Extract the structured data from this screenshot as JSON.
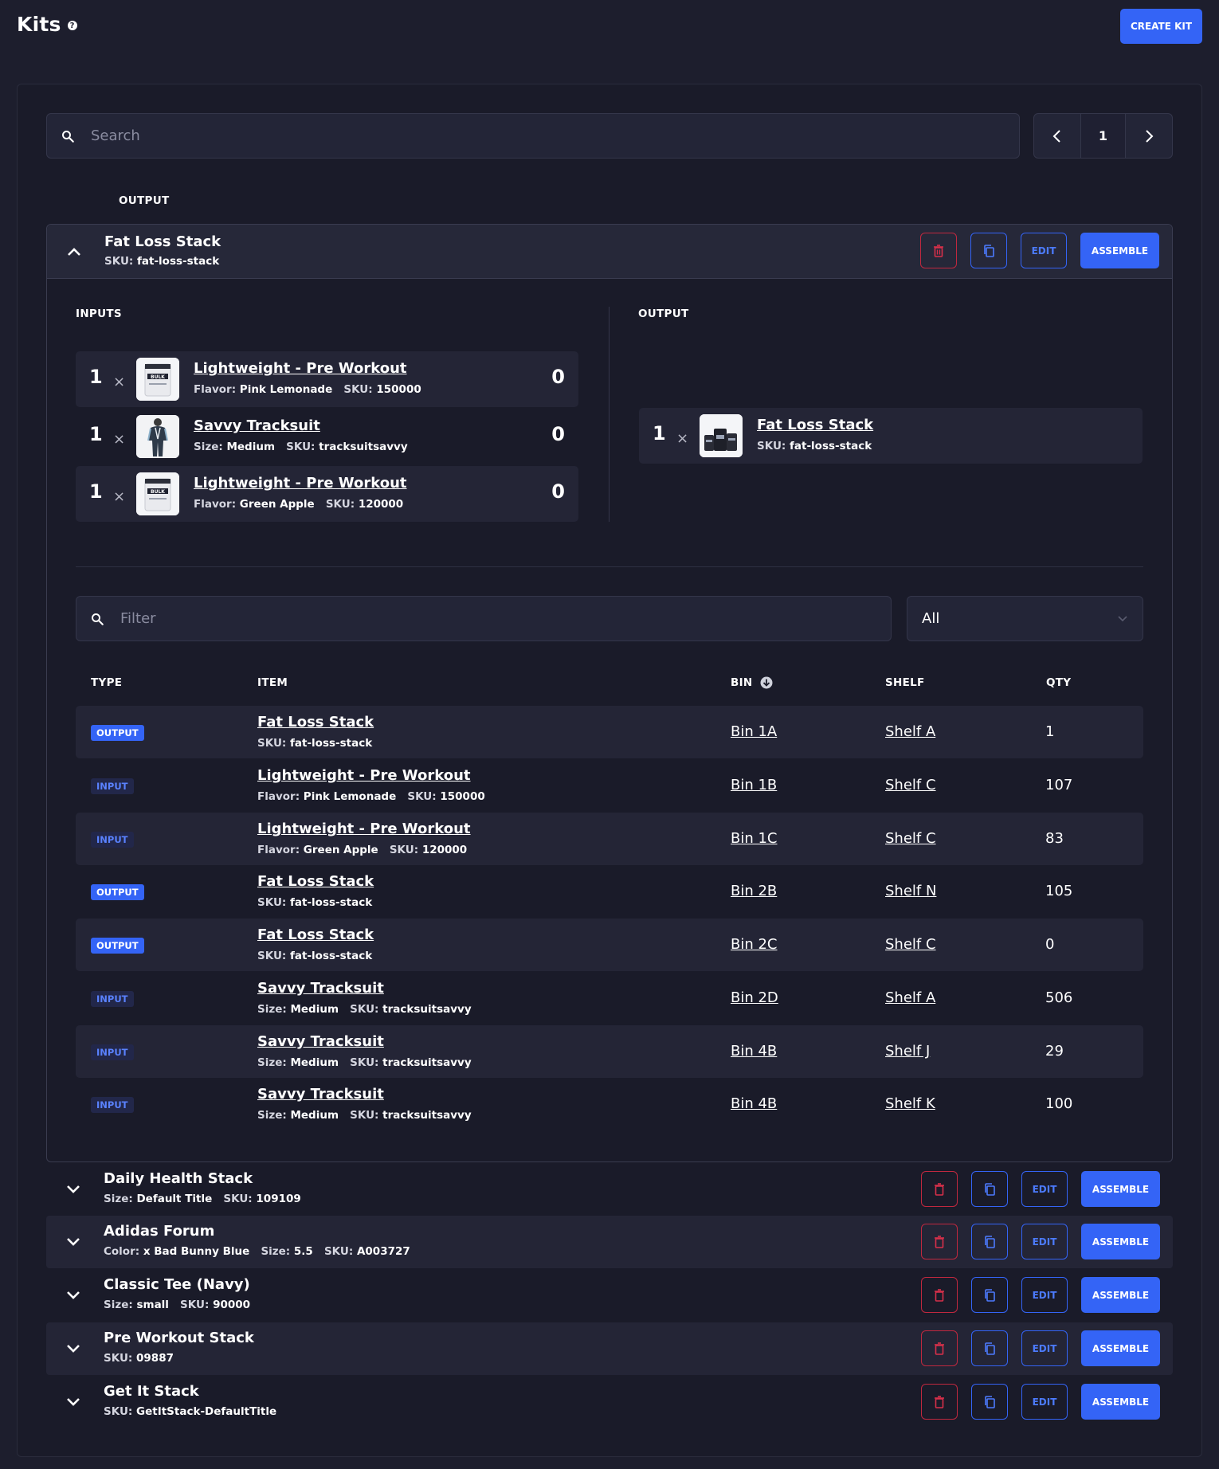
{
  "header": {
    "title": "Kits",
    "help_icon": "?",
    "create_button": "CREATE KIT"
  },
  "search": {
    "placeholder": "Search"
  },
  "pager": {
    "page": "1"
  },
  "list_header": {
    "output_label": "OUTPUT"
  },
  "actions": {
    "edit": "EDIT",
    "assemble": "ASSEMBLE"
  },
  "expanded_kit": {
    "name": "Fat Loss Stack",
    "sku_label": "SKU:",
    "sku": "fat-loss-stack",
    "inputs_label": "INPUTS",
    "output_label": "OUTPUT",
    "inputs": [
      {
        "qty": "1",
        "x": "×",
        "name": "Lightweight - Pre Workout",
        "meta1_label": "Flavor:",
        "meta1": "Pink Lemonade",
        "sku_label": "SKU:",
        "sku": "150000",
        "stock": "0",
        "thumb": "bulk-tub"
      },
      {
        "qty": "1",
        "x": "×",
        "name": "Savvy Tracksuit",
        "meta1_label": "Size:",
        "meta1": "Medium",
        "sku_label": "SKU:",
        "sku": "tracksuitsavvy",
        "stock": "0",
        "thumb": "tracksuit"
      },
      {
        "qty": "1",
        "x": "×",
        "name": "Lightweight - Pre Workout",
        "meta1_label": "Flavor:",
        "meta1": "Green Apple",
        "sku_label": "SKU:",
        "sku": "120000",
        "stock": "0",
        "thumb": "bulk-tub"
      }
    ],
    "output": {
      "qty": "1",
      "x": "×",
      "name": "Fat Loss Stack",
      "sku_label": "SKU:",
      "sku": "fat-loss-stack",
      "thumb": "stack-bottles"
    },
    "filter": {
      "placeholder": "Filter",
      "select_value": "All"
    },
    "table": {
      "headers": {
        "type": "TYPE",
        "item": "ITEM",
        "bin": "BIN",
        "shelf": "SHELF",
        "qty": "QTY"
      },
      "rows": [
        {
          "type": "OUTPUT",
          "item": "Fat Loss Stack",
          "meta": "",
          "meta_label": "",
          "sku_label": "SKU:",
          "sku": "fat-loss-stack",
          "bin": "Bin 1A",
          "shelf": "Shelf A",
          "qty": "1"
        },
        {
          "type": "INPUT",
          "item": "Lightweight - Pre Workout",
          "meta_label": "Flavor:",
          "meta": "Pink Lemonade",
          "sku_label": "SKU:",
          "sku": "150000",
          "bin": "Bin 1B",
          "shelf": "Shelf C",
          "qty": "107"
        },
        {
          "type": "INPUT",
          "item": "Lightweight - Pre Workout",
          "meta_label": "Flavor:",
          "meta": "Green Apple",
          "sku_label": "SKU:",
          "sku": "120000",
          "bin": "Bin 1C",
          "shelf": "Shelf C",
          "qty": "83"
        },
        {
          "type": "OUTPUT",
          "item": "Fat Loss Stack",
          "meta_label": "",
          "meta": "",
          "sku_label": "SKU:",
          "sku": "fat-loss-stack",
          "bin": "Bin 2B",
          "shelf": "Shelf N",
          "qty": "105"
        },
        {
          "type": "OUTPUT",
          "item": "Fat Loss Stack",
          "meta_label": "",
          "meta": "",
          "sku_label": "SKU:",
          "sku": "fat-loss-stack",
          "bin": "Bin 2C",
          "shelf": "Shelf C",
          "qty": "0"
        },
        {
          "type": "INPUT",
          "item": "Savvy Tracksuit",
          "meta_label": "Size:",
          "meta": "Medium",
          "sku_label": "SKU:",
          "sku": "tracksuitsavvy",
          "bin": "Bin 2D",
          "shelf": "Shelf A",
          "qty": "506"
        },
        {
          "type": "INPUT",
          "item": "Savvy Tracksuit",
          "meta_label": "Size:",
          "meta": "Medium",
          "sku_label": "SKU:",
          "sku": "tracksuitsavvy",
          "bin": "Bin 4B",
          "shelf": "Shelf J",
          "qty": "29"
        },
        {
          "type": "INPUT",
          "item": "Savvy Tracksuit",
          "meta_label": "Size:",
          "meta": "Medium",
          "sku_label": "SKU:",
          "sku": "tracksuitsavvy",
          "bin": "Bin 4B",
          "shelf": "Shelf K",
          "qty": "100"
        }
      ]
    }
  },
  "collapsed_kits": [
    {
      "name": "Daily Health Stack",
      "meta": [
        {
          "label": "Size:",
          "value": "Default Title"
        },
        {
          "label": "SKU:",
          "value": "109109"
        }
      ]
    },
    {
      "name": "Adidas Forum",
      "meta": [
        {
          "label": "Color:",
          "value": "x Bad Bunny Blue"
        },
        {
          "label": "Size:",
          "value": "5.5"
        },
        {
          "label": "SKU:",
          "value": "A003727"
        }
      ]
    },
    {
      "name": "Classic Tee (Navy)",
      "meta": [
        {
          "label": "Size:",
          "value": "small"
        },
        {
          "label": "SKU:",
          "value": "90000"
        }
      ]
    },
    {
      "name": "Pre Workout Stack",
      "meta": [
        {
          "label": "SKU:",
          "value": "09887"
        }
      ]
    },
    {
      "name": "Get It Stack",
      "meta": [
        {
          "label": "SKU:",
          "value": "GetItStack-DefaultTitle"
        }
      ]
    }
  ],
  "colors": {
    "background": "#1d1e2d",
    "accent": "#3464f6",
    "danger": "#c0283f",
    "row_shade": "#242536"
  }
}
